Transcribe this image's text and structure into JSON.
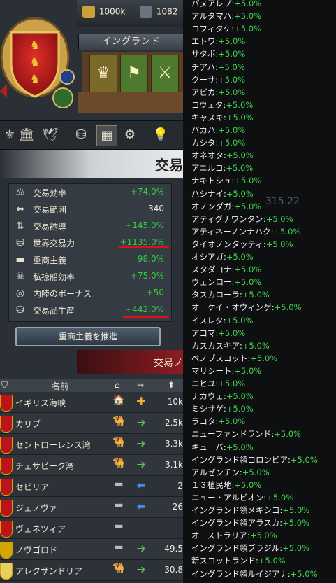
{
  "top_bar": {
    "treasury": "1000k",
    "manpower": "1082"
  },
  "nation": {
    "name": "イングランド"
  },
  "panel": {
    "title": "交易"
  },
  "stats": [
    {
      "label": "交易効率",
      "value": "+74.0%",
      "color": "green",
      "icon": "scales-icon"
    },
    {
      "label": "交易範囲",
      "value": "340",
      "color": "white",
      "icon": "range-icon"
    },
    {
      "label": "交易誘導",
      "value": "+145.0%",
      "color": "green",
      "icon": "steer-icon"
    },
    {
      "label": "世界交易力",
      "value": "+1135.0%",
      "color": "green",
      "icon": "trade-power-icon"
    },
    {
      "label": "重商主義",
      "value": "98.0%",
      "color": "green",
      "icon": "mercantilism-icon"
    },
    {
      "label": "私掠船効率",
      "value": "+75.0%",
      "color": "green",
      "icon": "privateer-icon"
    },
    {
      "label": "内陸のボーナス",
      "value": "+50",
      "color": "green",
      "icon": "inland-icon"
    },
    {
      "label": "交易品生産",
      "value": "+442.0%",
      "color": "green",
      "icon": "goods-icon"
    }
  ],
  "promote_button": "重商主義を推進",
  "nodes_ribbon": "交易ノ",
  "table": {
    "header_name": "名前",
    "rows": [
      {
        "name": "イギリス海峡",
        "value": "10k",
        "action": "home"
      },
      {
        "name": "カリブ",
        "value": "2.5k",
        "action": "forward"
      },
      {
        "name": "セントローレンス湾",
        "value": "3.3k",
        "action": "forward"
      },
      {
        "name": "チェサピーク湾",
        "value": "3.1k",
        "action": "forward"
      },
      {
        "name": "セビリア",
        "value": "2",
        "action": "back"
      },
      {
        "name": "ジェノヴァ",
        "value": "26",
        "action": "back"
      },
      {
        "name": "ヴェネツィア",
        "value": "",
        "action": "none"
      },
      {
        "name": "ノヴゴロド",
        "value": "49.5",
        "action": "forward"
      },
      {
        "name": "アレクサンドリア",
        "value": "30.8",
        "action": "forward"
      }
    ]
  },
  "tooltip": {
    "entries": [
      {
        "name": "パヌアレプ",
        "value": "+5.0%"
      },
      {
        "name": "アルタマハ",
        "value": "+5.0%"
      },
      {
        "name": "コフィタケ",
        "value": "+5.0%"
      },
      {
        "name": "エトワ",
        "value": "+5.0%"
      },
      {
        "name": "サタポ",
        "value": "+5.0%"
      },
      {
        "name": "チアハ",
        "value": "+5.0%"
      },
      {
        "name": "クーサ",
        "value": "+5.0%"
      },
      {
        "name": "アビカ",
        "value": "+5.0%"
      },
      {
        "name": "コウェタ",
        "value": "+5.0%"
      },
      {
        "name": "キャスキ",
        "value": "+5.0%"
      },
      {
        "name": "バカハ",
        "value": "+5.0%"
      },
      {
        "name": "カシタ",
        "value": "+5.0%"
      },
      {
        "name": "オネオタ",
        "value": "+5.0%"
      },
      {
        "name": "アニルコ",
        "value": "+5.0%"
      },
      {
        "name": "ナキトシュ",
        "value": "+5.0%"
      },
      {
        "name": "ハシナイ",
        "value": "+5.0%"
      },
      {
        "name": "オノンダガ",
        "value": "+5.0%"
      },
      {
        "name": "アティグナワンタン",
        "value": "+5.0%"
      },
      {
        "name": "アティネーノンナハク",
        "value": "+5.0%"
      },
      {
        "name": "タイオノンタッティ",
        "value": "+5.0%"
      },
      {
        "name": "オシアガ",
        "value": "+5.0%"
      },
      {
        "name": "スタダコナ",
        "value": "+5.0%"
      },
      {
        "name": "ウェンロー",
        "value": "+5.0%"
      },
      {
        "name": "タスカローラ",
        "value": "+5.0%"
      },
      {
        "name": "オーケイ・オウィンゲ",
        "value": "+5.0%"
      },
      {
        "name": "イスレタ",
        "value": "+5.0%"
      },
      {
        "name": "アコマ",
        "value": "+5.0%"
      },
      {
        "name": "カスカスキア",
        "value": "+5.0%"
      },
      {
        "name": "ペノブスコット",
        "value": "+5.0%"
      },
      {
        "name": "マリシート",
        "value": "+5.0%"
      },
      {
        "name": "ニヒユ",
        "value": "+5.0%"
      },
      {
        "name": "ナカウェ",
        "value": "+5.0%"
      },
      {
        "name": "ミシサゲ",
        "value": "+5.0%"
      },
      {
        "name": "ラコタ",
        "value": "+5.0%"
      },
      {
        "name": "ニューファンドランド",
        "value": "+5.0%"
      },
      {
        "name": "キューバ",
        "value": "+5.0%"
      },
      {
        "name": "イングランド領コロンビア",
        "value": "+5.0%"
      },
      {
        "name": "アルゼンチン",
        "value": "+5.0%"
      },
      {
        "name": "１３植民地",
        "value": "+5.0%"
      },
      {
        "name": "ニュー・アルビオン",
        "value": "+5.0%"
      },
      {
        "name": "イングランド領メキシコ",
        "value": "+5.0%"
      },
      {
        "name": "イングランド領アラスカ",
        "value": "+5.0%"
      },
      {
        "name": "オーストラリア",
        "value": "+5.0%"
      },
      {
        "name": "イングランド領ブラジル",
        "value": "+5.0%"
      },
      {
        "name": "新スコットランド",
        "value": "+5.0%"
      },
      {
        "name": "イングランド領ルイジアナ",
        "value": "+5.0%"
      }
    ]
  },
  "background_text": {
    "number": "315.22"
  }
}
